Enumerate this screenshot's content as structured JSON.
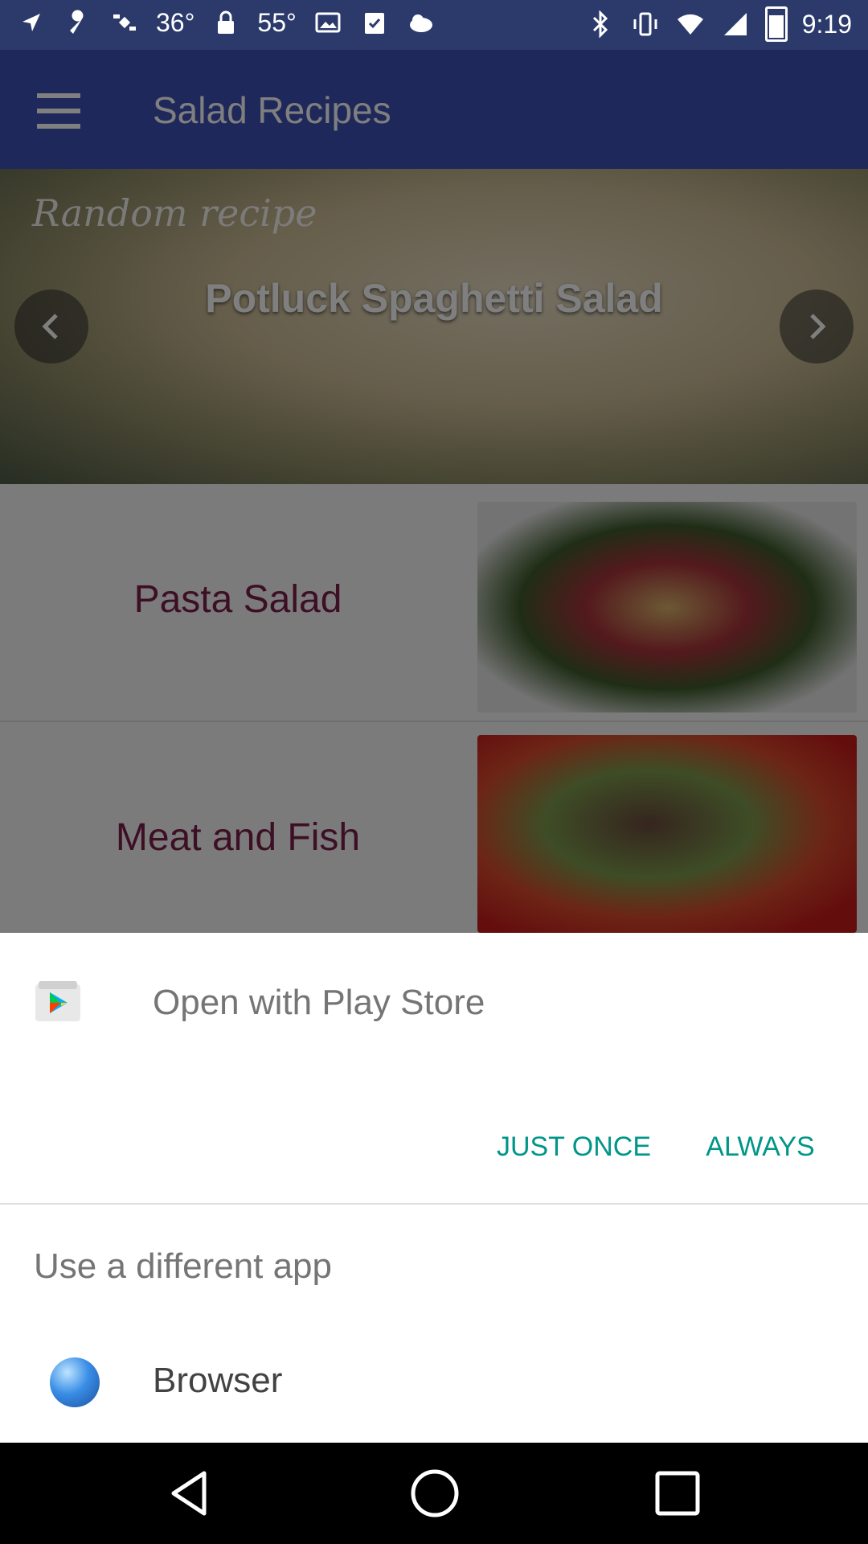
{
  "status_bar": {
    "time": "9:19",
    "temperature_1": "36°",
    "temperature_2": "55°",
    "icons_left": [
      "location-arrow-icon",
      "wrench-icon",
      "satellite-icon",
      "thermometer-text",
      "lock-icon",
      "thermometer-text",
      "photo-icon",
      "check-clipboard-icon",
      "weather-icon"
    ],
    "icons_right": [
      "bluetooth-icon",
      "vibrate-icon",
      "wifi-icon",
      "signal-icon",
      "battery-icon"
    ]
  },
  "app": {
    "title": "Salad Recipes",
    "hero": {
      "tagline": "Random recipe",
      "recipe_name": "Potluck Spaghetti Salad"
    },
    "categories": [
      {
        "label": "Pasta Salad"
      },
      {
        "label": "Meat and Fish"
      }
    ]
  },
  "dialog": {
    "open_with": "Open with Play Store",
    "just_once": "JUST ONCE",
    "always": "ALWAYS",
    "use_different": "Use a different app",
    "apps": [
      {
        "label": "Browser"
      }
    ],
    "accent_color": "#009688"
  },
  "colors": {
    "toolbar": "#3f51b5",
    "category_text": "#7a1e4a"
  }
}
